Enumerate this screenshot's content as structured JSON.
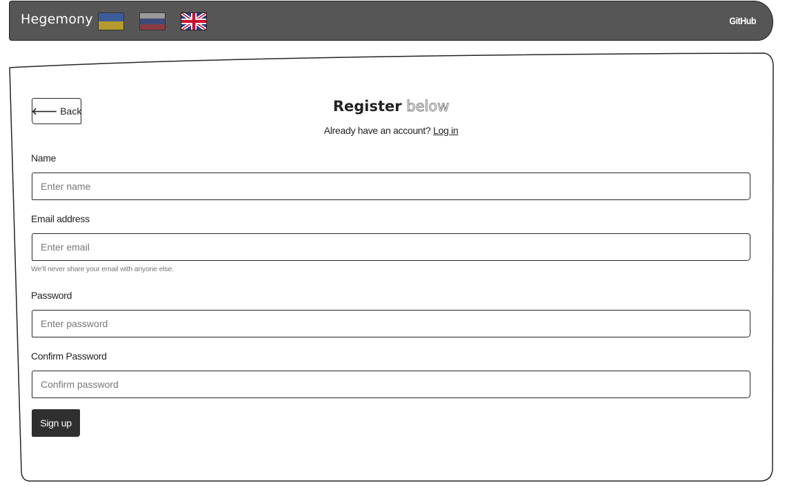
{
  "navbar": {
    "brand": "Hegemony",
    "languages": [
      {
        "code": "uk",
        "icon": "ukraine-flag-icon"
      },
      {
        "code": "ru",
        "icon": "russia-flag-icon"
      },
      {
        "code": "en",
        "icon": "uk-flag-icon"
      }
    ],
    "github_label": "GitHub",
    "colors": {
      "background": "#565656",
      "text": "#ffffff"
    }
  },
  "register": {
    "back_label": "Back",
    "back_icon": "arrow-left-icon",
    "title_strong": "Register",
    "title_light": "below",
    "have_account_text": "Already have an account?",
    "login_link": "Log in"
  },
  "form": {
    "name": {
      "label": "Name",
      "placeholder": "Enter name",
      "value": ""
    },
    "email": {
      "label": "Email address",
      "placeholder": "Enter email",
      "value": "",
      "help": "We'll never share your email with anyone else."
    },
    "password": {
      "label": "Password",
      "placeholder": "Enter password",
      "value": ""
    },
    "confirm_password": {
      "label": "Confirm Password",
      "placeholder": "Confirm password",
      "value": ""
    },
    "submit_label": "Sign up",
    "colors": {
      "submit_background": "#2f2f2f",
      "submit_text": "#ffffff"
    }
  }
}
